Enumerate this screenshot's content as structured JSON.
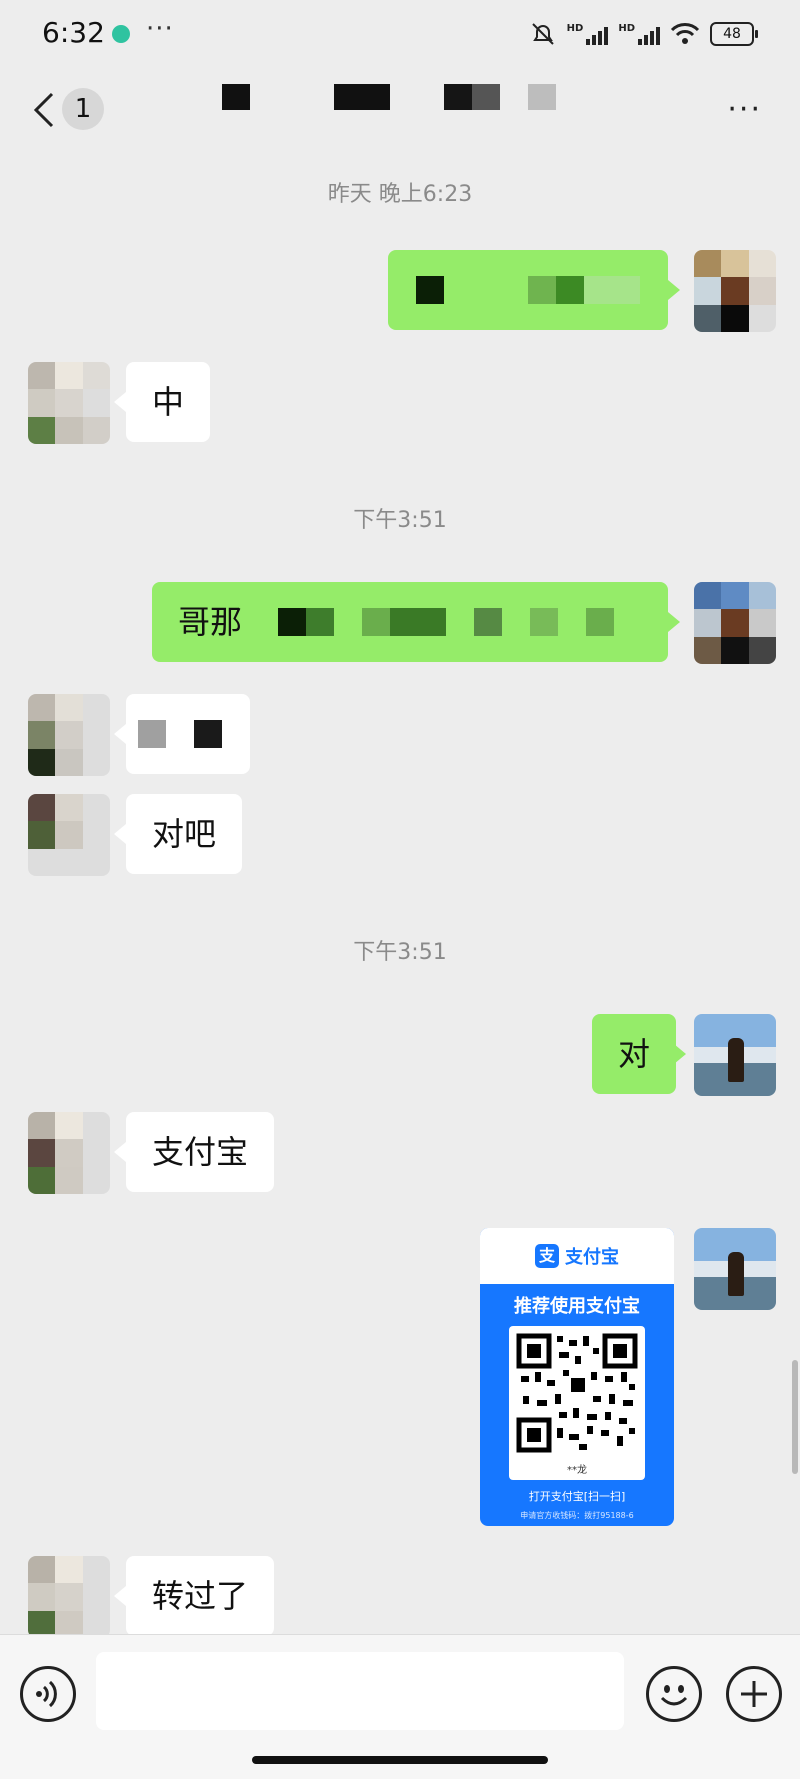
{
  "status_bar": {
    "time": "6:32",
    "more": "···",
    "hd1": "HD",
    "hd2": "HD",
    "battery": "48"
  },
  "nav": {
    "unread_badge": "1",
    "more": "···"
  },
  "messages": [
    {
      "kind": "timestamp",
      "text": "昨天 晚上6:23"
    },
    {
      "kind": "outgoing",
      "text": ""
    },
    {
      "kind": "incoming",
      "text": "中"
    },
    {
      "kind": "timestamp",
      "text": "下午3:51"
    },
    {
      "kind": "outgoing",
      "text": "哥那"
    },
    {
      "kind": "incoming",
      "text": ""
    },
    {
      "kind": "incoming",
      "text": "对吧"
    },
    {
      "kind": "timestamp",
      "text": "下午3:51"
    },
    {
      "kind": "outgoing",
      "text": "对"
    },
    {
      "kind": "incoming",
      "text": "支付宝"
    },
    {
      "kind": "outgoing-image",
      "text": ""
    },
    {
      "kind": "incoming",
      "text": "转过了"
    }
  ],
  "alipay_card": {
    "logo_glyph": "支",
    "brand": "支付宝",
    "slogan": "推荐使用支付宝",
    "payee": "**龙",
    "cta": "打开支付宝[扫一扫]",
    "footer": "申请官方收钱码：拨打95188-6"
  },
  "input": {
    "placeholder": ""
  },
  "colors": {
    "outgoing_bubble": "#95ec69",
    "incoming_bubble": "#ffffff",
    "background": "#ededed",
    "alipay_blue": "#1677ff"
  },
  "icons": [
    "back-icon",
    "more-icon",
    "voice-icon",
    "emoji-icon",
    "plus-icon",
    "wifi-icon",
    "mute-icon"
  ]
}
